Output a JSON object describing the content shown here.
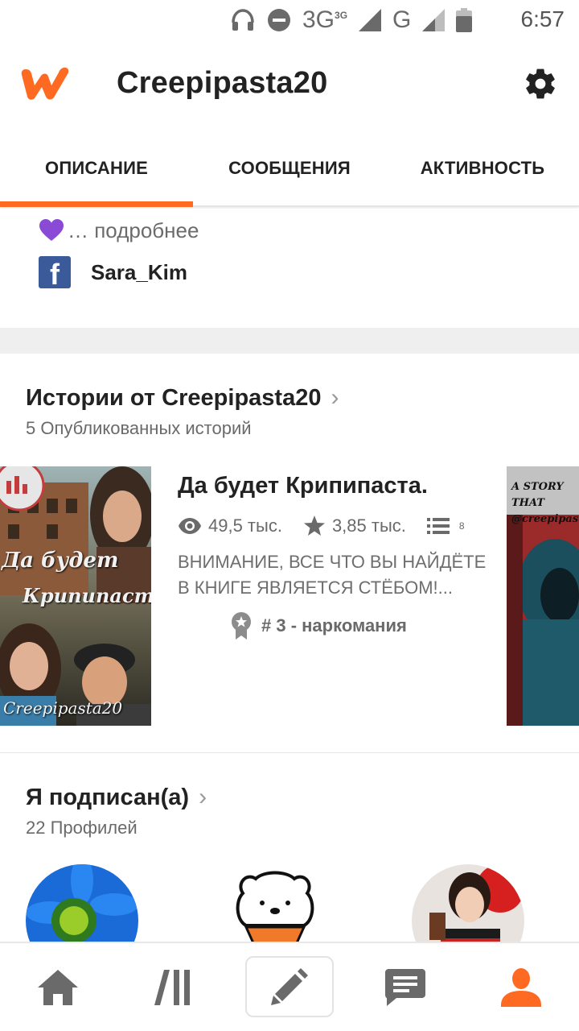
{
  "status_bar": {
    "network_1": "3G",
    "network_1_sup": "3G",
    "network_2": "G",
    "time": "6:57",
    "icons": [
      "headphones-icon",
      "do-not-disturb-icon",
      "signal-icon",
      "battery-icon"
    ]
  },
  "header": {
    "title": "Creepipasta20",
    "logo": "wattpad-logo",
    "settings_icon": "gear-icon"
  },
  "tabs": [
    {
      "label": "ОПИСАНИЕ",
      "active": true
    },
    {
      "label": "СООБЩЕНИЯ",
      "active": false
    },
    {
      "label": "АКТИВНОСТЬ",
      "active": false
    }
  ],
  "about": {
    "more_text": "… подробнее",
    "facebook_name": "Sara_Kim"
  },
  "stories": {
    "title": "Истории от Creepipasta20",
    "subtitle": "5 Опубликованных историй",
    "story": {
      "title": "Да будет Крипипаста.",
      "reads": "49,5 тыс.",
      "votes": "3,85 тыс.",
      "parts": "8",
      "description": "ВНИМАНИЕ, ВСЕ ЧТО ВЫ НАЙДЁТЕ В КНИГЕ ЯВЛЯЕТСЯ СТЁБОМ!...",
      "rank": "# 3 - наркомания"
    },
    "cover_left": {
      "title_line1": "Да будет",
      "title_line2": "Крипипаста",
      "author": "Creepipasta20"
    },
    "cover_right": {
      "text_line1": "A STORY THAT",
      "text_line2": "@creepipasta"
    }
  },
  "following": {
    "title": "Я подписан(а)",
    "subtitle": "22 Профилей"
  },
  "bottom_nav": [
    {
      "icon": "home-icon"
    },
    {
      "icon": "library-icon"
    },
    {
      "icon": "pencil-icon"
    },
    {
      "icon": "messages-icon"
    },
    {
      "icon": "profile-icon"
    }
  ],
  "colors": {
    "accent": "#ff6a22",
    "heart": "#8a4ad6",
    "facebook": "#3b5a9a"
  }
}
